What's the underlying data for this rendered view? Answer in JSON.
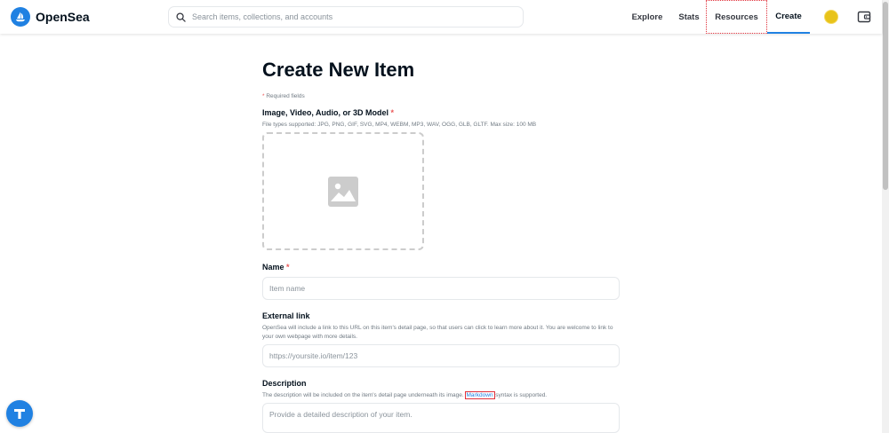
{
  "brand": {
    "name": "OpenSea",
    "accent": "#2081e2"
  },
  "search": {
    "placeholder": "Search items, collections, and accounts"
  },
  "nav": {
    "explore": "Explore",
    "stats": "Stats",
    "resources": "Resources",
    "create": "Create"
  },
  "page": {
    "title": "Create New Item",
    "required_note_mark": "*",
    "required_note": " Required fields"
  },
  "media": {
    "label": "Image, Video, Audio, or 3D Model",
    "required_mark": "*",
    "help": "File types supported: JPG, PNG, GIF, SVG, MP4, WEBM, MP3, WAV, OGG, GLB, GLTF. Max size: 100 MB"
  },
  "name_field": {
    "label": "Name",
    "required_mark": "*",
    "placeholder": "Item name"
  },
  "external_link": {
    "label": "External link",
    "help": "OpenSea will include a link to this URL on this item's detail page, so that users can click to learn more about it. You are welcome to link to your own webpage with more details.",
    "placeholder": "https://yoursite.io/item/123"
  },
  "description": {
    "label": "Description",
    "help_before": "The description will be included on the item's detail page underneath its image. ",
    "help_link": "Markdown",
    "help_after": " syntax is supported.",
    "placeholder": "Provide a detailed description of your item."
  },
  "icons": {
    "logo": "sailboat-logo-icon",
    "search": "search-icon",
    "avatar": "user-avatar",
    "wallet": "wallet-icon",
    "image_placeholder": "image-icon",
    "floating": "t-badge-icon"
  }
}
